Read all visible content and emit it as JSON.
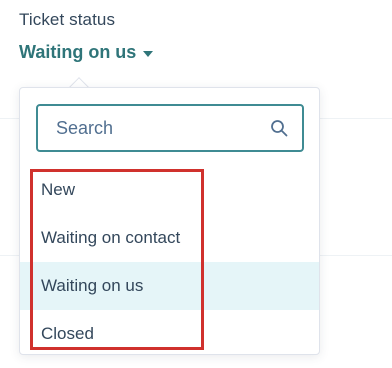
{
  "field": {
    "label": "Ticket status",
    "value": "Waiting on us"
  },
  "search": {
    "placeholder": "Search"
  },
  "options": [
    {
      "label": "New",
      "selected": false
    },
    {
      "label": "Waiting on contact",
      "selected": false
    },
    {
      "label": "Waiting on us",
      "selected": true
    },
    {
      "label": "Closed",
      "selected": false
    }
  ],
  "colors": {
    "accent": "#2f7579",
    "search_border": "#3f8b93",
    "selected_bg": "#e5f5f8",
    "highlight": "#d0312d"
  },
  "icons": {
    "trigger": "caret-down-icon",
    "search": "search-icon"
  }
}
